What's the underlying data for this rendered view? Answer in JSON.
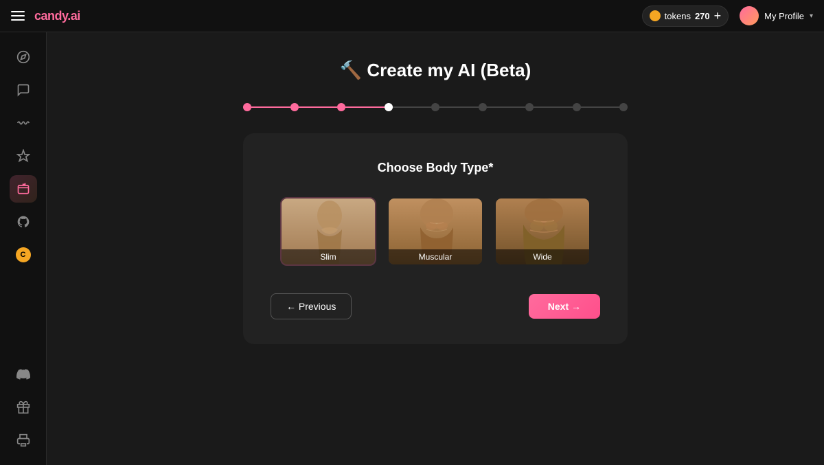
{
  "app": {
    "logo": "candy",
    "logo_tld": ".ai",
    "menu_icon": "☰"
  },
  "topnav": {
    "tokens_label": "tokens",
    "tokens_count": "270",
    "add_label": "+",
    "profile_label": "My Profile"
  },
  "sidebar": {
    "top_icons": [
      {
        "name": "compass-icon",
        "symbol": "◎",
        "active": false
      },
      {
        "name": "chat-icon",
        "symbol": "💬",
        "active": false
      },
      {
        "name": "wave-icon",
        "symbol": "〰",
        "active": false
      },
      {
        "name": "sparkle-icon",
        "symbol": "✦",
        "active": false
      },
      {
        "name": "wand-icon",
        "symbol": "✨",
        "active": true
      },
      {
        "name": "github-icon",
        "symbol": "⊙",
        "active": false
      },
      {
        "name": "coin-icon",
        "symbol": "🪙",
        "active": false
      }
    ],
    "bottom_icons": [
      {
        "name": "discord-icon",
        "symbol": "⊕",
        "active": false
      },
      {
        "name": "gift-icon",
        "symbol": "⊗",
        "active": false
      },
      {
        "name": "trophy-icon",
        "symbol": "🏆",
        "active": false
      }
    ]
  },
  "page": {
    "title": "🔨 Create my AI (Beta)"
  },
  "stepper": {
    "steps": [
      {
        "state": "completed"
      },
      {
        "state": "completed"
      },
      {
        "state": "completed"
      },
      {
        "state": "current"
      },
      {
        "state": "upcoming"
      },
      {
        "state": "upcoming"
      },
      {
        "state": "upcoming"
      },
      {
        "state": "upcoming"
      },
      {
        "state": "upcoming"
      }
    ]
  },
  "card": {
    "title": "Choose Body Type*",
    "body_options": [
      {
        "id": "slim",
        "label": "Slim"
      },
      {
        "id": "muscular",
        "label": "Muscular"
      },
      {
        "id": "wide",
        "label": "Wide"
      }
    ],
    "prev_label": "← Previous",
    "next_label": "Next →"
  }
}
